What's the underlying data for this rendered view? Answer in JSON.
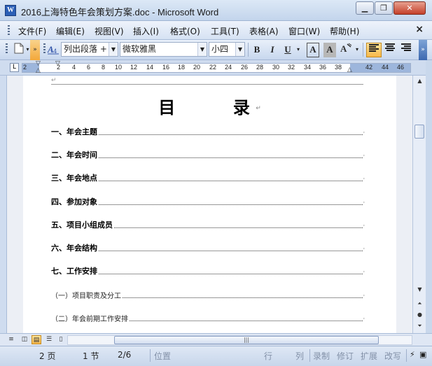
{
  "window": {
    "icon_letter": "W",
    "title": "2016上海特色年会策划方案.doc - Microsoft Word",
    "minimize": "▁",
    "restore": "❐",
    "close": "✕"
  },
  "menu": {
    "items": [
      "文件(F)",
      "编辑(E)",
      "视图(V)",
      "插入(I)",
      "格式(O)",
      "工具(T)",
      "表格(A)",
      "窗口(W)",
      "帮助(H)"
    ],
    "doc_close": "×"
  },
  "toolbar": {
    "style_value": "列出段落 + ",
    "font_value": "微软雅黑",
    "size_value": "小四",
    "bold": "B",
    "italic": "I",
    "underline": "U",
    "char_border": "A",
    "char_shade": "A",
    "highlight": "A"
  },
  "ruler": {
    "tab_selector": "L",
    "ticks": [
      "2",
      "2",
      "4",
      "6",
      "8",
      "10",
      "12",
      "14",
      "16",
      "18",
      "20",
      "22",
      "24",
      "26",
      "28",
      "30",
      "32",
      "34",
      "36",
      "38",
      "42",
      "44",
      "46"
    ]
  },
  "document": {
    "title_left": "目",
    "title_right": "录",
    "toc": [
      {
        "label": "一、年会主题",
        "level": 1
      },
      {
        "label": "二、年会时间",
        "level": 1
      },
      {
        "label": "三、年会地点",
        "level": 1
      },
      {
        "label": "四、参加对象",
        "level": 1
      },
      {
        "label": "五、项目小组成员",
        "level": 1
      },
      {
        "label": "六、年会结构",
        "level": 1
      },
      {
        "label": "七、工作安排",
        "level": 1
      },
      {
        "label": "（一）项目职责及分工",
        "level": 2
      },
      {
        "label": "（二）年会前期工作安排",
        "level": 2
      }
    ]
  },
  "statusbar": {
    "page": "2 页",
    "section": "1 节",
    "page_of": "2/6",
    "position": "位置",
    "line": "行",
    "column": "列",
    "record": "录制",
    "revise": "修订",
    "extend": "扩展",
    "overtype": "改写"
  }
}
